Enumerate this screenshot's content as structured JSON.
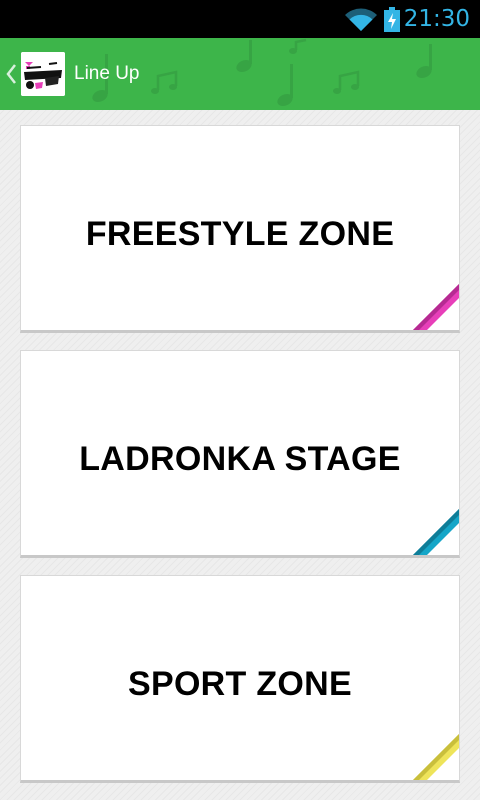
{
  "status_bar": {
    "time": "21:30",
    "wifi_icon": "wifi-icon",
    "battery_icon": "battery-charging-icon",
    "icon_color": "#33b5e5"
  },
  "action_bar": {
    "title": "Line Up",
    "background_color": "#3db54a",
    "up_icon": "chevron-left-icon",
    "logo": "app-logo"
  },
  "zones": [
    {
      "label": "FREESTYLE ZONE",
      "accent_color": "#e73fb9"
    },
    {
      "label": "LADRONKA STAGE",
      "accent_color": "#15a6c8"
    },
    {
      "label": "SPORT ZONE",
      "accent_color": "#eee45a"
    }
  ]
}
